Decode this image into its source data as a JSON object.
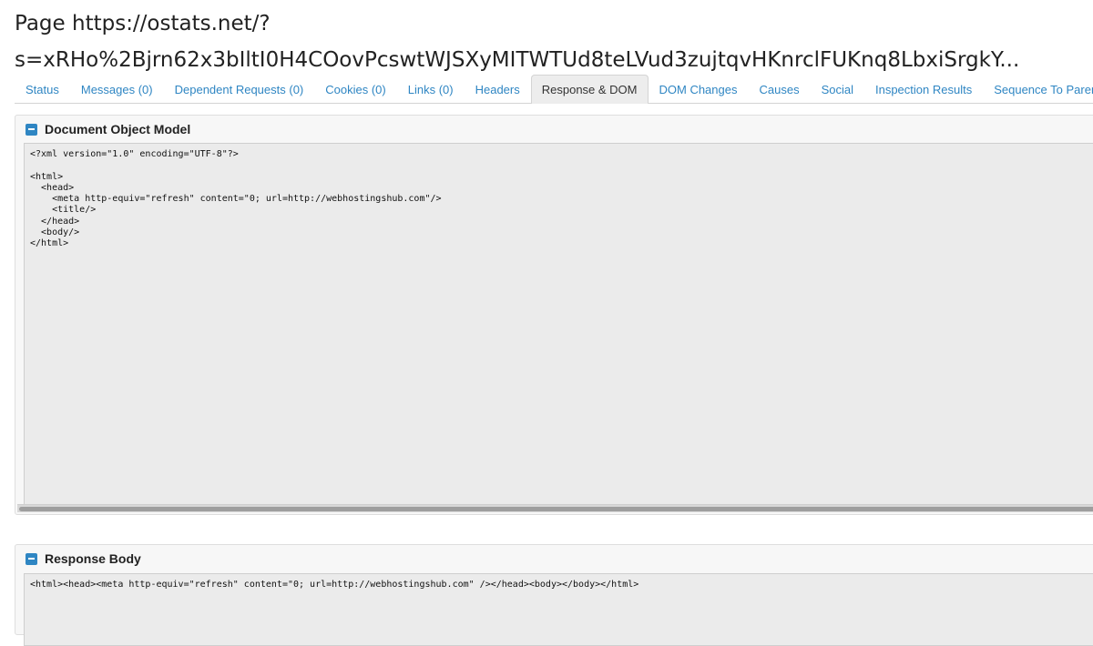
{
  "header": {
    "title_line1": "Page https://ostats.net/?",
    "title_line2": "s=xRHo%2Bjrn62x3bIltI0H4COovPcswtWJSXyMITWTUd8teLVud3zujtqvHKnrclFUKnq8LbxiSrgkY..."
  },
  "tabs": [
    {
      "label": "Status"
    },
    {
      "label": "Messages (0)"
    },
    {
      "label": "Dependent Requests (0)"
    },
    {
      "label": "Cookies (0)"
    },
    {
      "label": "Links (0)"
    },
    {
      "label": "Headers"
    },
    {
      "label": "Response & DOM",
      "active": true
    },
    {
      "label": "DOM Changes"
    },
    {
      "label": "Causes"
    },
    {
      "label": "Social"
    },
    {
      "label": "Inspection Results"
    },
    {
      "label": "Sequence To Parent"
    }
  ],
  "dom_panel": {
    "title": "Document Object Model",
    "code": "<?xml version=\"1.0\" encoding=\"UTF-8\"?>\n\n<html>\n  <head>\n    <meta http-equiv=\"refresh\" content=\"0; url=http://webhostingshub.com\"/>\n    <title/>\n  </head>\n  <body/>\n</html>"
  },
  "response_panel": {
    "title": "Response Body",
    "code": "<html><head><meta http-equiv=\"refresh\" content=\"0; url=http://webhostingshub.com\" /></head><body></body></html>"
  }
}
